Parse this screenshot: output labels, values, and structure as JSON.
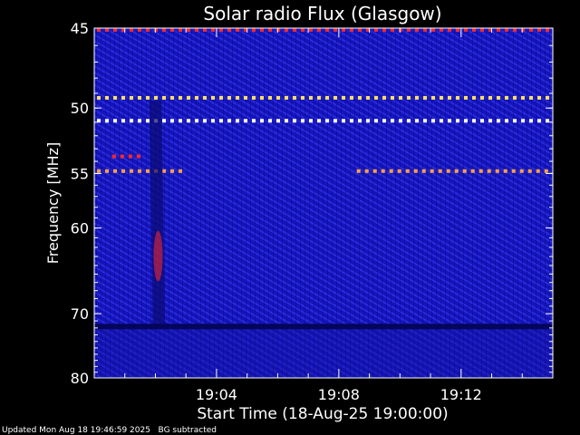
{
  "chart_data": {
    "type": "heatmap",
    "title": "Solar radio Flux (Glasgow)",
    "xlabel": "Start Time (18-Aug-25 19:00:00)",
    "ylabel": "Frequency [MHz]",
    "x_range_minutes": [
      0,
      15
    ],
    "y_range_mhz": [
      45,
      80
    ],
    "x_ticks": [
      {
        "minute": 4,
        "label": "19:04"
      },
      {
        "minute": 8,
        "label": "19:08"
      },
      {
        "minute": 12,
        "label": "19:12"
      }
    ],
    "y_ticks": [
      {
        "mhz": 45,
        "label": "45"
      },
      {
        "mhz": 50,
        "label": "50"
      },
      {
        "mhz": 55,
        "label": "55"
      },
      {
        "mhz": 60,
        "label": "60"
      },
      {
        "mhz": 70,
        "label": "70"
      },
      {
        "mhz": 80,
        "label": "80"
      }
    ],
    "colormap": [
      "#000080",
      "#1a1aff",
      "#3a3aff",
      "#ff2020",
      "#ffa040",
      "#ffffff"
    ],
    "background_color": "#1010b0",
    "features": [
      {
        "kind": "interference_line",
        "mhz": 45.1,
        "from_min": 0,
        "to_min": 15,
        "level": "red"
      },
      {
        "kind": "interference_line",
        "mhz": 49.3,
        "from_min": 0,
        "to_min": 15,
        "level": "yellow"
      },
      {
        "kind": "interference_line",
        "mhz": 50.9,
        "from_min": 0,
        "to_min": 15,
        "level": "white"
      },
      {
        "kind": "interference_line",
        "mhz": 53.6,
        "from_min": 0.5,
        "to_min": 1.5,
        "level": "red"
      },
      {
        "kind": "interference_line",
        "mhz": 54.8,
        "from_min": 0,
        "to_min": 3.0,
        "level": "orange"
      },
      {
        "kind": "interference_line",
        "mhz": 54.8,
        "from_min": 8.5,
        "to_min": 15,
        "level": "orange"
      },
      {
        "kind": "burst_streak",
        "from_min": 1.8,
        "to_min": 2.2,
        "mhz_from": 55,
        "mhz_to": 72,
        "level": "red"
      },
      {
        "kind": "band_gap",
        "mhz": 71.8
      }
    ]
  },
  "footer": {
    "updated": "Updated Mon Aug 18 19:46:59 2025",
    "note": "BG subtracted"
  }
}
